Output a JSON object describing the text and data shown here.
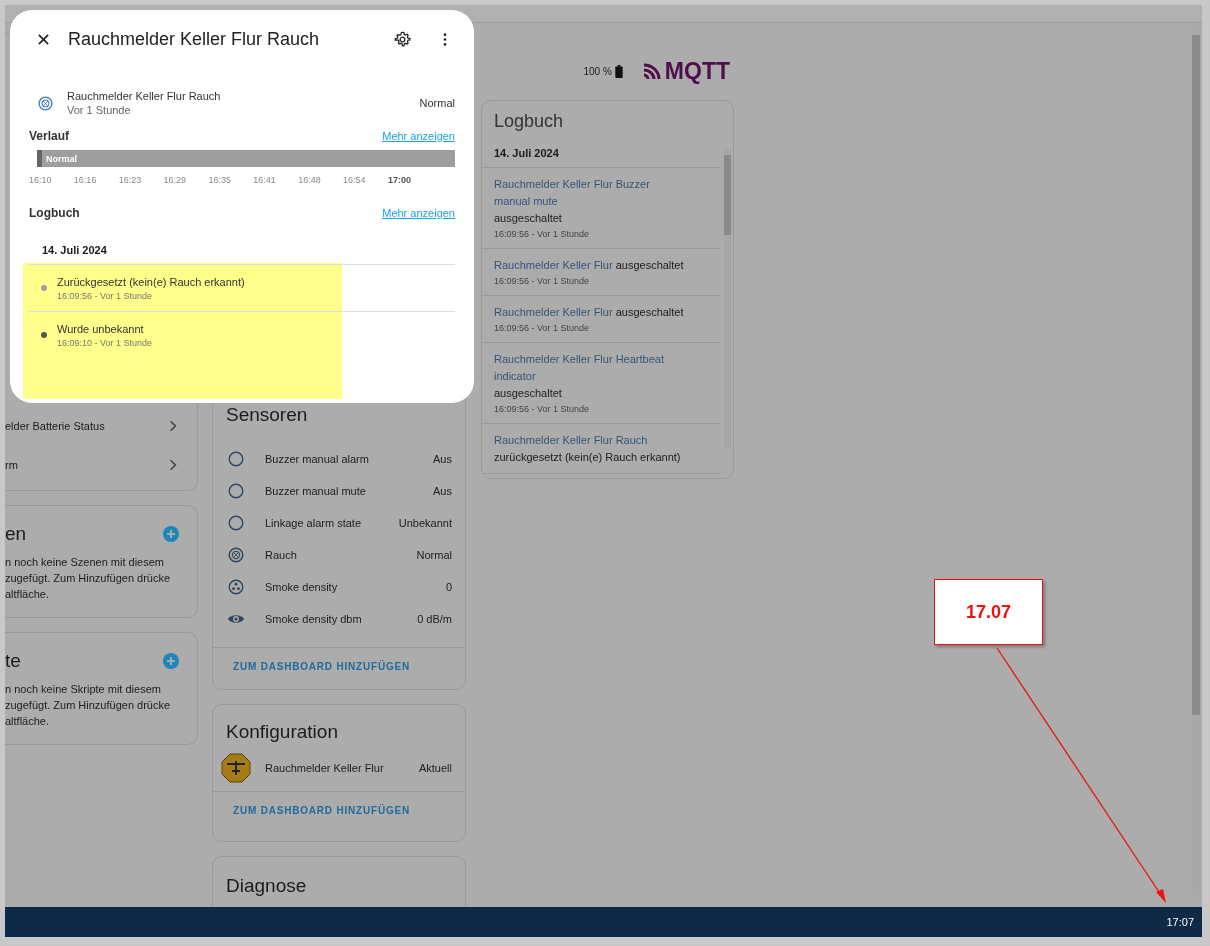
{
  "dialog": {
    "title": "Rauchmelder Keller Flur Rauch",
    "entity": {
      "name": "Rauchmelder Keller Flur Rauch",
      "updated": "Vor 1 Stunde",
      "state": "Normal"
    },
    "history": {
      "title": "Verlauf",
      "more_link": "Mehr anzeigen",
      "segment_label": "Normal",
      "ticks": [
        {
          "label": "16:10",
          "major": false
        },
        {
          "label": "16:16",
          "major": false
        },
        {
          "label": "16:23",
          "major": false
        },
        {
          "label": "16:29",
          "major": false
        },
        {
          "label": "16:35",
          "major": false
        },
        {
          "label": "16:41",
          "major": false
        },
        {
          "label": "16:48",
          "major": false
        },
        {
          "label": "16:54",
          "major": false
        },
        {
          "label": "17:00",
          "major": true
        }
      ]
    },
    "logbook": {
      "title": "Logbuch",
      "more_link": "Mehr anzeigen",
      "date": "14. Juli 2024",
      "entries": [
        {
          "text": "Zurückgesetzt (kein(e) Rauch erkannt)",
          "time": "16:09:56 - Vor 1 Stunde",
          "color": "#9e9e9e"
        },
        {
          "text": "Wurde unbekannt",
          "time": "16:09:10 - Vor 1 Stunde",
          "color": "#555555"
        }
      ]
    }
  },
  "left_column": {
    "items": [
      {
        "label": "elder Batterie Status"
      },
      {
        "label": "rm"
      }
    ],
    "cards": [
      {
        "title": "en",
        "text": "n noch keine Szenen mit diesem\nzugefügt. Zum Hinzufügen drücke\naltfläche."
      },
      {
        "title": "te",
        "text": "n noch keine Skripte mit diesem\nzugefügt. Zum Hinzufügen drücke\naltfläche."
      }
    ]
  },
  "sensors": {
    "title": "Sensoren",
    "rows": [
      {
        "kind": "circle",
        "name": "Buzzer manual alarm",
        "value": "Aus"
      },
      {
        "kind": "circle",
        "name": "Buzzer manual mute",
        "value": "Aus"
      },
      {
        "kind": "circle",
        "name": "Linkage alarm state",
        "value": "Unbekannt"
      },
      {
        "kind": "smoke",
        "name": "Rauch",
        "value": "Normal"
      },
      {
        "kind": "dots",
        "name": "Smoke density",
        "value": "0"
      },
      {
        "kind": "eye",
        "name": "Smoke density dbm",
        "value": "0 dB/m"
      }
    ],
    "action": "ZUM DASHBOARD HINZUFÜGEN"
  },
  "configuration": {
    "title": "Konfiguration",
    "rows": [
      {
        "name": "Rauchmelder Keller Flur",
        "value": "Aktuell"
      }
    ],
    "action": "ZUM DASHBOARD HINZUFÜGEN"
  },
  "diagnostics": {
    "title": "Diagnose"
  },
  "device_info": {
    "battery": "100 %",
    "logo_text": "MQTT"
  },
  "logbook_card": {
    "title": "Logbuch",
    "date": "14. Juli 2024",
    "entries": [
      {
        "entity": "Rauchmelder Keller Flur Buzzer manual mute",
        "action": "ausgeschaltet",
        "time": "16:09:56 - Vor 1 Stunde"
      },
      {
        "entity": "Rauchmelder Keller Flur",
        "action": "ausgeschaltet",
        "time": "16:09:56 - Vor 1 Stunde"
      },
      {
        "entity": "Rauchmelder Keller Flur",
        "action": "ausgeschaltet",
        "time": "16:09:56 - Vor 1 Stunde"
      },
      {
        "entity": "Rauchmelder Keller Flur Heartbeat indicator",
        "action": "ausgeschaltet",
        "time": "16:09:56 - Vor 1 Stunde"
      },
      {
        "entity": "Rauchmelder Keller Flur Rauch",
        "action": "zurückgesetzt (kein(e) Rauch erkannt)"
      }
    ]
  },
  "callout": {
    "text": "17.07"
  },
  "taskbar": {
    "time": "17:07"
  }
}
